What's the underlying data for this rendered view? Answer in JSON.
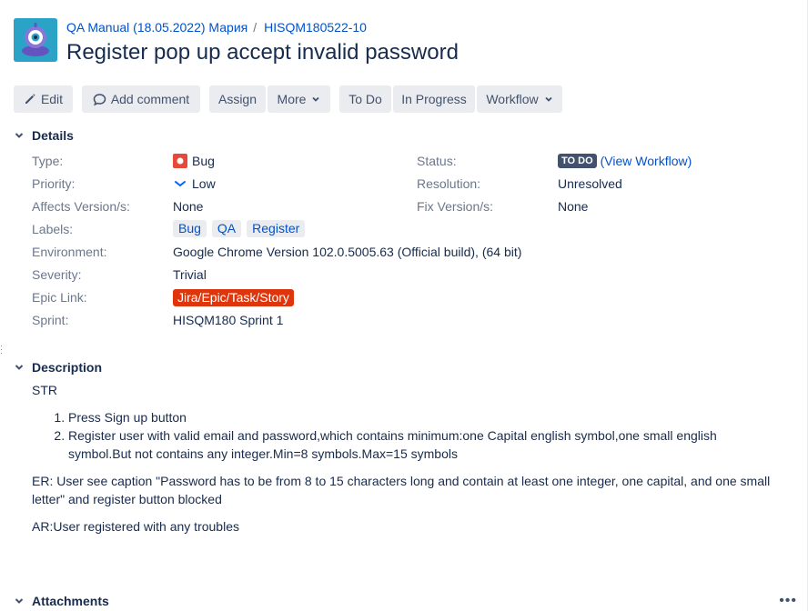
{
  "breadcrumb": {
    "project": "QA Manual (18.05.2022) Мария",
    "separator": "/",
    "issue_key": "HISQM180522-10"
  },
  "summary": "Register pop up accept invalid password",
  "toolbar": {
    "edit": "Edit",
    "add_comment": "Add comment",
    "assign": "Assign",
    "more": "More",
    "to_do": "To Do",
    "in_progress": "In Progress",
    "workflow": "Workflow"
  },
  "details": {
    "heading": "Details",
    "type": {
      "label": "Type:",
      "value": "Bug"
    },
    "priority": {
      "label": "Priority:",
      "value": "Low"
    },
    "affects": {
      "label": "Affects Version/s:",
      "value": "None"
    },
    "labels": {
      "label": "Labels:",
      "values": [
        "Bug",
        "QA",
        "Register"
      ]
    },
    "environment": {
      "label": "Environment:",
      "value": "Google Chrome Version 102.0.5005.63 (Official build), (64 bit)"
    },
    "severity": {
      "label": "Severity:",
      "value": "Trivial"
    },
    "epic_link": {
      "label": "Epic Link:",
      "value": "Jira/Epic/Task/Story"
    },
    "sprint": {
      "label": "Sprint:",
      "value": "HISQM180 Sprint 1"
    },
    "status": {
      "label": "Status:",
      "value": "TO DO",
      "link": "(View Workflow)"
    },
    "resolution": {
      "label": "Resolution:",
      "value": "Unresolved"
    },
    "fix_version": {
      "label": "Fix Version/s:",
      "value": "None"
    }
  },
  "description": {
    "heading": "Description",
    "str": "STR",
    "steps": [
      "Press Sign up button",
      "Register user with valid email and password,which contains minimum:one Capital english symbol,one small english symbol.But not contains any integer.Min=8 symbols.Max=15 symbols"
    ],
    "er": "ER: User see caption \"Password has to be from 8 to 15 characters long and contain at least one integer, one capital, and one small letter\" and register button blocked",
    "ar": "AR:User registered with any troubles"
  },
  "attachments": {
    "heading": "Attachments",
    "more": "•••"
  },
  "colors": {
    "link": "#0052cc",
    "button_bg": "#ebecf0",
    "lozenge_todo": "#42526e",
    "epic": "#de350b",
    "bug": "#e5493a",
    "priority_low": "#0065ff"
  }
}
